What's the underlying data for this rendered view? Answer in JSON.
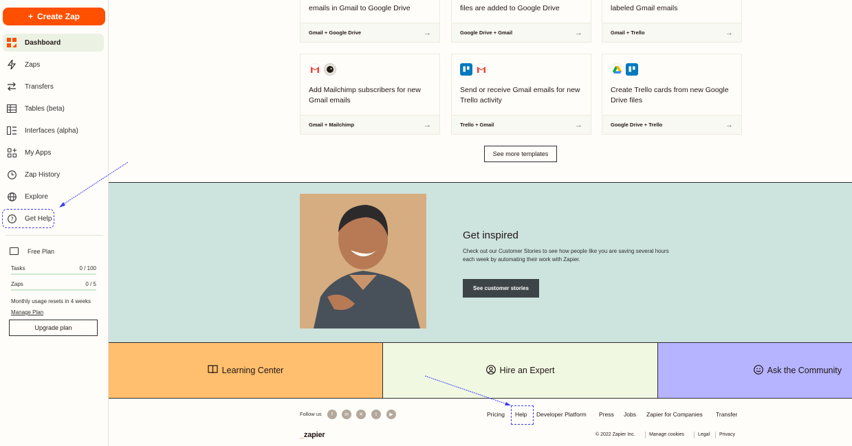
{
  "sidebar": {
    "create_label": "Create Zap",
    "items": [
      {
        "label": "Dashboard",
        "icon": "dashboard-icon"
      },
      {
        "label": "Zaps",
        "icon": "zap-icon"
      },
      {
        "label": "Transfers",
        "icon": "transfer-icon"
      },
      {
        "label": "Tables (beta)",
        "icon": "table-icon"
      },
      {
        "label": "Interfaces (alpha)",
        "icon": "interfaces-icon"
      },
      {
        "label": "My Apps",
        "icon": "apps-icon"
      },
      {
        "label": "Zap History",
        "icon": "history-icon"
      },
      {
        "label": "Explore",
        "icon": "globe-icon"
      },
      {
        "label": "Get Help",
        "icon": "help-icon"
      }
    ],
    "plan": {
      "title": "Free Plan",
      "tasks_label": "Tasks",
      "tasks_value": "0 / 100",
      "zaps_label": "Zaps",
      "zaps_value": "0 / 5",
      "reset_text": "Monthly usage resets in 4 weeks",
      "manage_label": "Manage Plan",
      "upgrade_label": "Upgrade plan"
    }
  },
  "templates": {
    "top_row": [
      {
        "title": "emails in Gmail to Google Drive",
        "apps": "Gmail + Google Drive"
      },
      {
        "title": "files are added to Google Drive",
        "apps": "Google Drive + Gmail"
      },
      {
        "title": "labeled Gmail emails",
        "apps": "Gmail + Trello"
      }
    ],
    "bottom_row": [
      {
        "title": "Add Mailchimp subscribers for new Gmail emails",
        "apps": "Gmail + Mailchimp"
      },
      {
        "title": "Send or receive Gmail emails for new Trello activity",
        "apps": "Trello + Gmail"
      },
      {
        "title": "Create Trello cards from new Google Drive files",
        "apps": "Google Drive + Trello"
      }
    ],
    "arrow": "→",
    "see_more_label": "See more templates"
  },
  "inspired": {
    "title": "Get inspired",
    "text": "Check out our Customer Stories to see how people like you are saving several hours each week by automating their work with Zapier.",
    "button_label": "See customer stories"
  },
  "resources": [
    {
      "label": "Learning Center",
      "color": "#ffbf6e"
    },
    {
      "label": "Hire an Expert",
      "color": "#f1f8e2"
    },
    {
      "label": "Ask the Community",
      "color": "#b6b4ff"
    }
  ],
  "footer": {
    "follow_label": "Follow us",
    "links": [
      "Pricing",
      "Help",
      "Developer Platform",
      "Press",
      "Jobs",
      "Zapier for Companies",
      "Transfer"
    ],
    "logo_dash": "_",
    "logo_text": "zapier",
    "copyright": "© 2022 Zapier Inc.",
    "legal_links": [
      "Manage cookies",
      "Legal",
      "Privacy"
    ]
  },
  "colors": {
    "accent": "#ff4f00",
    "annotation": "#3b3bf0"
  }
}
